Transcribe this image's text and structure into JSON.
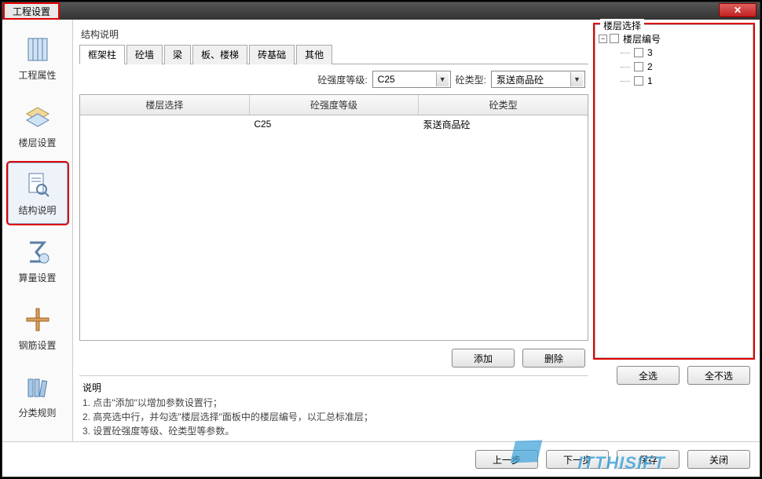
{
  "window": {
    "title": "工程设置"
  },
  "sidebar": {
    "items": [
      {
        "label": "工程属性"
      },
      {
        "label": "楼层设置"
      },
      {
        "label": "结构说明"
      },
      {
        "label": "算量设置"
      },
      {
        "label": "钢筋设置"
      },
      {
        "label": "分类规则"
      }
    ]
  },
  "main": {
    "title": "结构说明",
    "tabs": [
      {
        "label": "框架柱"
      },
      {
        "label": "砼墙"
      },
      {
        "label": "梁"
      },
      {
        "label": "板、楼梯"
      },
      {
        "label": "砖基础"
      },
      {
        "label": "其他"
      }
    ],
    "filters": {
      "strength_label": "砼强度等级:",
      "strength_value": "C25",
      "type_label": "砼类型:",
      "type_value": "泵送商品砼"
    },
    "columns": [
      "楼层选择",
      "砼强度等级",
      "砼类型"
    ],
    "rows": [
      {
        "floor": "",
        "strength": "C25",
        "type": "泵送商品砼"
      }
    ],
    "buttons": {
      "add": "添加",
      "del": "删除"
    }
  },
  "tree": {
    "title": "楼层选择",
    "root": "楼层编号",
    "children": [
      "3",
      "2",
      "1"
    ],
    "select_all": "全选",
    "select_none": "全不选"
  },
  "desc": {
    "title": "说明",
    "lines": [
      "1. 点击\"添加\"以增加参数设置行；",
      "2. 高亮选中行，并勾选\"楼层选择\"面板中的楼层编号，以汇总标准层；",
      "3. 设置砼强度等级、砼类型等参数。"
    ]
  },
  "wizard": {
    "prev": "上一步",
    "next": "下一步",
    "save": "保存",
    "close": "关闭"
  },
  "watermark": "ITTHISIFT"
}
